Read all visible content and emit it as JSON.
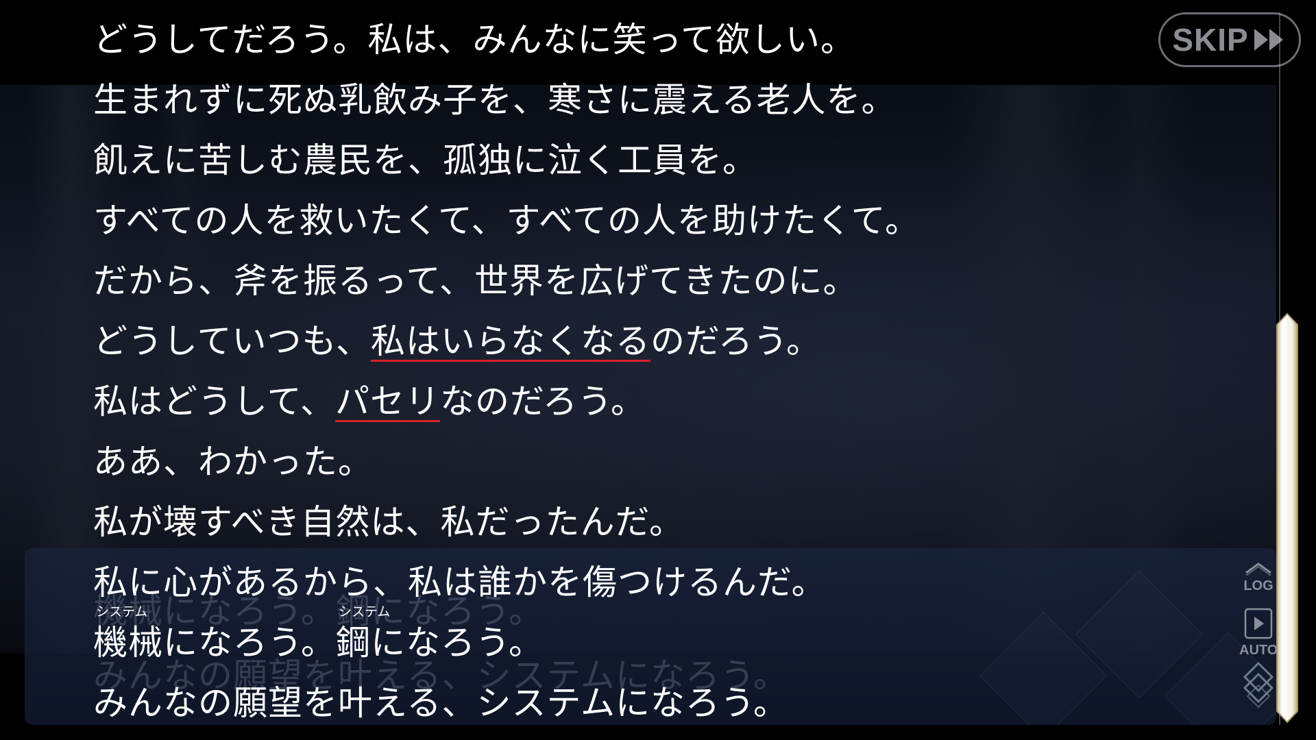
{
  "story_lines": [
    {
      "segments": [
        {
          "text": "どうしてだろう。私は、みんなに笑って欲しい。"
        }
      ]
    },
    {
      "segments": [
        {
          "text": "生まれずに死ぬ乳飲み子を、寒さに震える老人を。"
        }
      ]
    },
    {
      "segments": [
        {
          "text": "飢えに苦しむ農民を、孤独に泣く工員を。"
        }
      ]
    },
    {
      "segments": [
        {
          "text": "すべての人を救いたくて、すべての人を助けたくて。"
        }
      ]
    },
    {
      "segments": [
        {
          "text": "だから、斧を振るって、世界を広げてきたのに。"
        }
      ]
    },
    {
      "segments": [
        {
          "text": "どうしていつも、"
        },
        {
          "text": "私はいらなくなる"
        },
        {
          "text": "のだろう。"
        }
      ]
    },
    {
      "segments": [
        {
          "text": "私はどうして、"
        },
        {
          "text": "パセリ"
        },
        {
          "text": "なのだろう。"
        }
      ]
    },
    {
      "segments": [
        {
          "text": "ああ、わかった。"
        }
      ]
    },
    {
      "segments": [
        {
          "text": "私が壊すべき自然は、私だったんだ。"
        }
      ]
    },
    {
      "segments": [
        {
          "text": "私に心があるから、私は誰かを傷つけるんだ。"
        }
      ]
    },
    {
      "segments": [
        {
          "text": "機械",
          "ruby": "システム"
        },
        {
          "text": "になろう。"
        },
        {
          "text": "鋼",
          "ruby": "システム"
        },
        {
          "text": "になろう。"
        }
      ]
    },
    {
      "segments": [
        {
          "text": "みんなの願望を叶える、システムになろう。"
        }
      ]
    }
  ],
  "ghost_text": {
    "line1": "機械になろう。鋼になろう。",
    "line2": "みんなの願望を叶える、システムになろう。"
  },
  "controls": {
    "skip_label": "SKIP",
    "log_label": "LOG",
    "auto_label": "AUTO"
  },
  "colors": {
    "text": "#ffffff",
    "underline": "#d8212a",
    "button_gray": "#8a8d93",
    "textbox_bg": "#1a2440"
  },
  "icons": {
    "skip": "double-chevron-right-icon",
    "log": "chevron-up-icon",
    "auto": "play-icon",
    "menu": "diamond-menu-icon"
  }
}
